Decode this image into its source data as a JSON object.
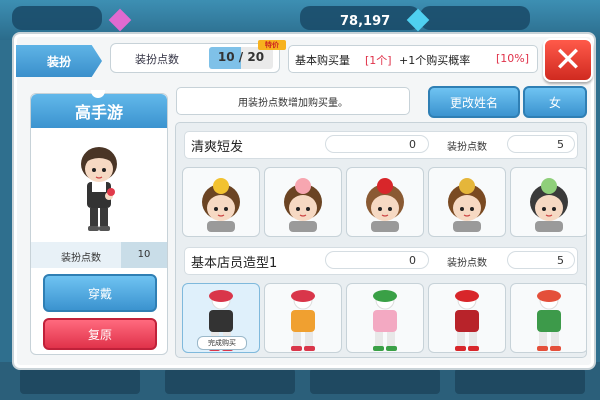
{
  "background": {
    "top_currency_1": "…",
    "top_currency_2": "78,197"
  },
  "header": {
    "tab_label": "装扮",
    "dress_points_label": "装扮点数",
    "dress_points_value": "10 / 20",
    "dress_points_fraction": 0.5,
    "badge_text": "特价",
    "buy_label": "基本购买量",
    "buy_value": "[1个]",
    "rate_label": "+1个购买概率",
    "rate_value": "[10%]"
  },
  "character": {
    "name": "高手游",
    "points_label": "装扮点数",
    "points_value": "10",
    "wear_button": "穿戴",
    "reset_button": "复原"
  },
  "toolbar": {
    "hint": "用装扮点数增加购买量。",
    "rename_button": "更改姓名",
    "gender_button": "女"
  },
  "categories": [
    {
      "title": "清爽短发",
      "count": "0",
      "points_label": "装扮点数",
      "points": "5",
      "items": [
        {
          "icon": "avatar-yellow-bun-hair",
          "hair": "#6b4423",
          "acc": "#f2c230"
        },
        {
          "icon": "avatar-peach-hat",
          "hair": "#6b4423",
          "acc": "#f7a6b0"
        },
        {
          "icon": "avatar-santa-hat",
          "hair": "#8a5a33",
          "acc": "#d8262a"
        },
        {
          "icon": "avatar-braided-hair",
          "hair": "#7a4a22",
          "acc": "#e5b63a"
        },
        {
          "icon": "avatar-green-face",
          "hair": "#3a3a3a",
          "acc": "#8fcf7a"
        }
      ]
    },
    {
      "title": "基本店员造型1",
      "count": "0",
      "points_label": "装扮点数",
      "points": "5",
      "items": [
        {
          "icon": "outfit-mushroom-hat",
          "top": "#333333",
          "acc": "#d9364a",
          "completed": "完成购买"
        },
        {
          "icon": "outfit-orange-dress",
          "top": "#f0a030",
          "acc": "#d9364a"
        },
        {
          "icon": "outfit-pink-clover",
          "top": "#f3a9c2",
          "acc": "#3aa046"
        },
        {
          "icon": "outfit-red-dress",
          "top": "#b8232a",
          "acc": "#d8262a"
        },
        {
          "icon": "outfit-hanbok",
          "top": "#3d9a4a",
          "acc": "#e44f3a"
        }
      ]
    }
  ],
  "colors": {
    "accent_blue": "#3b93cf",
    "reset_red": "#e0324a",
    "close_red": "#d02a20",
    "rate_pink": "#e0324a"
  }
}
